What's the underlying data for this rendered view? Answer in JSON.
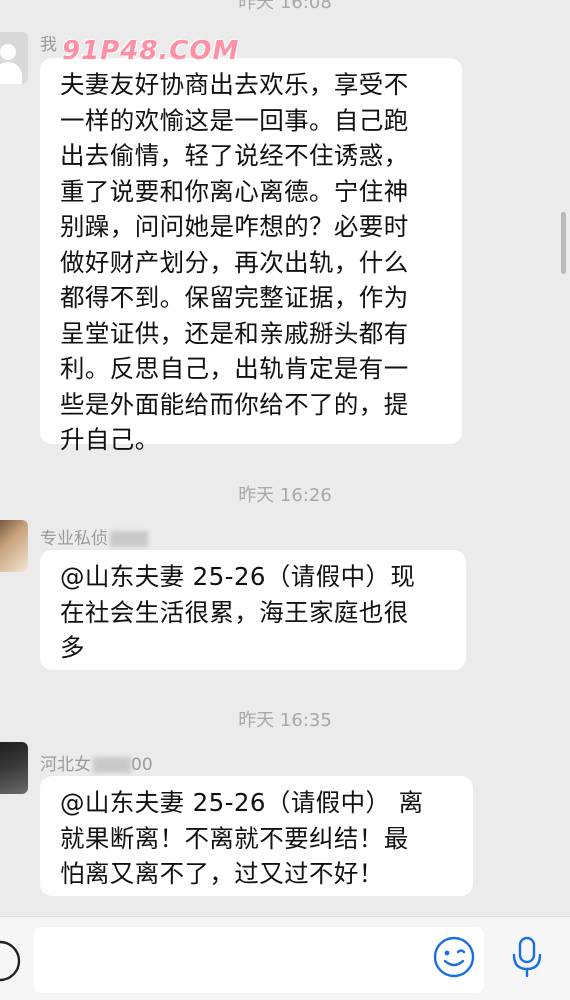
{
  "watermark": "91P48.COM",
  "timestamps": {
    "t0": "昨天 16:08",
    "t1": "昨天 16:26",
    "t2": "昨天 16:35"
  },
  "messages": [
    {
      "sender": "我",
      "lines": [
        "夫妻友好协商出去欢乐，享受不",
        "一样的欢愉这是一回事。自己跑",
        "出去偷情，轻了说经不住诱惑，",
        "重了说要和你离心离德。宁住神",
        "别躁，问问她是咋想的？必要时",
        "做好财产划分，再次出轨，什么",
        "都得不到。保留完整证据，作为",
        "呈堂证供，还是和亲戚掰头都有",
        "利。反思自己，出轨肯定是有一",
        "些是外面能给而你给不了的，提",
        "升自己。"
      ]
    },
    {
      "sender": "专业私侦",
      "lines": [
        "@山东夫妻 25-26（请假中）现",
        "在社会生活很累，海王家庭也很",
        "多"
      ]
    },
    {
      "sender": "河北女",
      "sender_suffix": "00",
      "lines": [
        "@山东夫妻 25-26（请假中） 离",
        "就果断离！不离就不要纠结！最",
        "怕离又离不了，过又过不好！"
      ]
    }
  ],
  "input": {
    "placeholder": ""
  },
  "icons": {
    "left": "voice-toggle-icon",
    "emoji": "emoji-icon",
    "mic": "microphone-icon"
  },
  "colors": {
    "background": "#ebebeb",
    "bubble": "#ffffff",
    "timestamp": "#a8a8a8",
    "watermark": "#ff8fa5"
  }
}
